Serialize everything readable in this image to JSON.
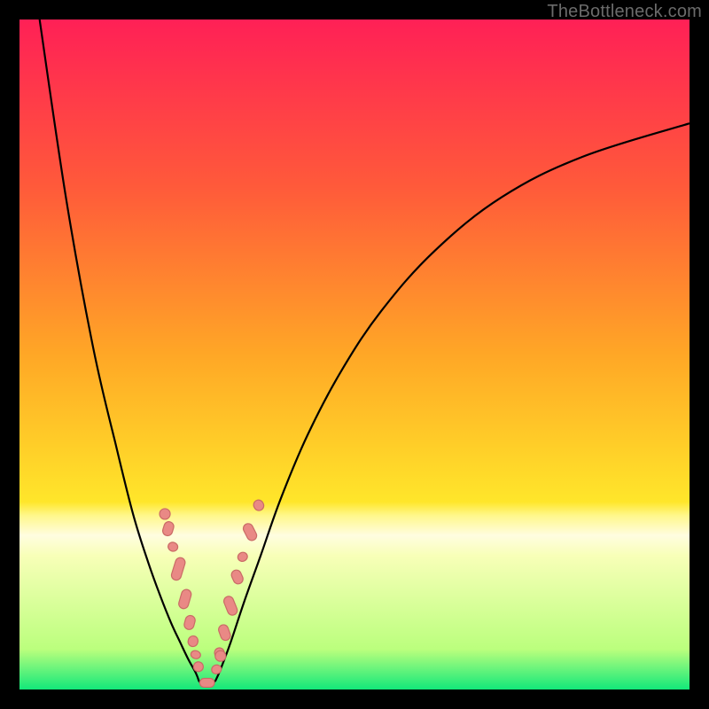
{
  "watermark": "TheBottleneck.com",
  "gradient": {
    "c0": "#ff2056",
    "c1": "#ff5a3a",
    "c2": "#ffa726",
    "c3": "#ffe62a",
    "c4": "#fff78a",
    "c5": "#fffde0",
    "c6": "#f8ffb8",
    "c7": "#bbff7d",
    "c8": "#12e87a"
  },
  "chart_data": {
    "type": "line",
    "title": "",
    "xlabel": "",
    "ylabel": "",
    "x_range": [
      0,
      100
    ],
    "y_range": [
      0,
      100
    ],
    "series": [
      {
        "name": "left-branch",
        "x": [
          3.0,
          7.0,
          11.0,
          14.5,
          17.0,
          19.2,
          21.0,
          22.6,
          24.0,
          25.2,
          26.3,
          26.8
        ],
        "y": [
          100.0,
          73.0,
          51.0,
          36.0,
          26.0,
          19.0,
          14.0,
          10.0,
          7.0,
          4.5,
          2.5,
          1.2
        ]
      },
      {
        "name": "right-branch",
        "x": [
          29.2,
          30.0,
          31.5,
          33.5,
          36.0,
          39.0,
          43.0,
          48.0,
          54.0,
          62.0,
          72.0,
          84.0,
          100.0
        ],
        "y": [
          1.2,
          3.0,
          7.0,
          13.0,
          20.0,
          28.5,
          38.0,
          47.5,
          56.5,
          65.5,
          73.5,
          79.5,
          84.5
        ]
      },
      {
        "name": "valley-floor",
        "x": [
          26.8,
          27.5,
          28.2,
          29.2
        ],
        "y": [
          1.2,
          0.7,
          0.7,
          1.2
        ]
      }
    ],
    "beads_left": [
      {
        "x_pct": 22.2,
        "y_pct": 24.0,
        "len": 16,
        "angle": -73
      },
      {
        "x_pct": 22.9,
        "y_pct": 21.3,
        "len": 10,
        "angle": -73
      },
      {
        "x_pct": 23.7,
        "y_pct": 18.0,
        "len": 26,
        "angle": -73
      },
      {
        "x_pct": 24.7,
        "y_pct": 13.5,
        "len": 22,
        "angle": -74
      },
      {
        "x_pct": 25.4,
        "y_pct": 10.0,
        "len": 16,
        "angle": -75
      },
      {
        "x_pct": 25.9,
        "y_pct": 7.2,
        "len": 12,
        "angle": -76
      },
      {
        "x_pct": 26.3,
        "y_pct": 5.2,
        "len": 9,
        "angle": -77
      },
      {
        "x_pct": 26.7,
        "y_pct": 3.4,
        "len": 11,
        "angle": -78
      }
    ],
    "beads_right": [
      {
        "x_pct": 29.4,
        "y_pct": 3.0,
        "len": 10,
        "angle": 72
      },
      {
        "x_pct": 29.9,
        "y_pct": 5.3,
        "len": 14,
        "angle": 71
      },
      {
        "x_pct": 30.6,
        "y_pct": 8.5,
        "len": 18,
        "angle": 70
      },
      {
        "x_pct": 31.5,
        "y_pct": 12.5,
        "len": 22,
        "angle": 68
      },
      {
        "x_pct": 32.5,
        "y_pct": 16.8,
        "len": 16,
        "angle": 66
      },
      {
        "x_pct": 33.3,
        "y_pct": 19.8,
        "len": 10,
        "angle": 65
      },
      {
        "x_pct": 34.4,
        "y_pct": 23.5,
        "len": 20,
        "angle": 63
      },
      {
        "x_pct": 35.7,
        "y_pct": 27.5,
        "len": 12,
        "angle": 61
      }
    ],
    "round_beads": [
      {
        "x_pct": 21.7,
        "y_pct": 26.2,
        "r": 6
      },
      {
        "x_pct": 30.0,
        "y_pct": 5.0,
        "r": 6
      }
    ],
    "valley_segment": {
      "x1_pct": 26.9,
      "x2_pct": 29.1,
      "y_pct": 1.0
    }
  }
}
